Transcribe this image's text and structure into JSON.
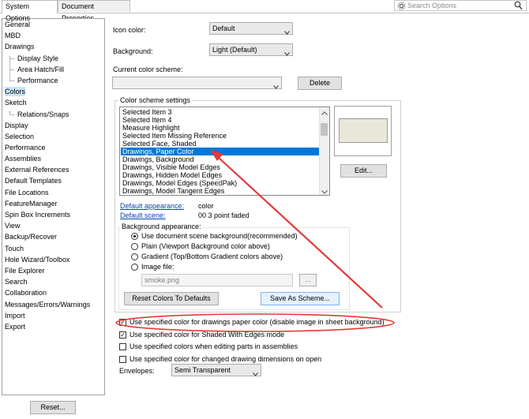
{
  "tabs": [
    {
      "label": "System Options"
    },
    {
      "label": "Document Properties"
    }
  ],
  "search": {
    "placeholder": "Search Options"
  },
  "tree": {
    "items": [
      {
        "label": "General"
      },
      {
        "label": "MBD"
      },
      {
        "label": "Drawings"
      },
      {
        "label": "Display Style"
      },
      {
        "label": "Area Hatch/Fill"
      },
      {
        "label": "Performance"
      },
      {
        "label": "Colors"
      },
      {
        "label": "Sketch"
      },
      {
        "label": "Relations/Snaps"
      },
      {
        "label": "Display"
      },
      {
        "label": "Selection"
      },
      {
        "label": "Performance"
      },
      {
        "label": "Assemblies"
      },
      {
        "label": "External References"
      },
      {
        "label": "Default Templates"
      },
      {
        "label": "File Locations"
      },
      {
        "label": "FeatureManager"
      },
      {
        "label": "Spin Box Increments"
      },
      {
        "label": "View"
      },
      {
        "label": "Backup/Recover"
      },
      {
        "label": "Touch"
      },
      {
        "label": "Hole Wizard/Toolbox"
      },
      {
        "label": "File Explorer"
      },
      {
        "label": "Search"
      },
      {
        "label": "Collaboration"
      },
      {
        "label": "Messages/Errors/Warnings"
      },
      {
        "label": "Import"
      },
      {
        "label": "Export"
      }
    ],
    "reset_label": "Reset..."
  },
  "icon_color": {
    "label": "Icon color:",
    "value": "Default"
  },
  "background": {
    "label": "Background:",
    "value": "Light (Default)"
  },
  "scheme": {
    "label": "Current color scheme:",
    "value": "",
    "delete_label": "Delete"
  },
  "settings": {
    "group_label": "Color scheme settings",
    "items": [
      "Selected Item 3",
      "Selected Item 4",
      "Measure Highlight",
      "Selected Item Missing Reference",
      "Selected Face, Shaded",
      "Drawings, Paper Color",
      "Drawings, Background",
      "Drawings, Visible Model Edges",
      "Drawings, Hidden Model Edges",
      "Drawings, Model Edges (SpeedPak)",
      "Drawings, Model Tangent Edges"
    ],
    "selected_index": 5,
    "edit_label": "Edit...",
    "swatch_color": "#e9e7da",
    "default_appearance_label": "Default appearance:",
    "default_appearance_value": "color",
    "default_scene_label": "Default scene:",
    "default_scene_value": "00 3 point faded",
    "bg_appearance_label": "Background appearance:",
    "radios": [
      "Use document scene background(recommended)",
      "Plain (Viewport Background color above)",
      "Gradient (Top/Bottom Gradient colors above)",
      "Image file:"
    ],
    "image_file": "smoke.png",
    "browse_label": "...",
    "reset_colors_label": "Reset Colors To Defaults",
    "save_scheme_label": "Save As Scheme..."
  },
  "checks": [
    {
      "label": "Use specified color for drawings paper color (disable image in sheet background)",
      "checked": true
    },
    {
      "label": "Use specified color for Shaded With Edges mode",
      "checked": true
    },
    {
      "label": "Use specified colors when editing parts in assemblies",
      "checked": false
    },
    {
      "label": "Use specified color for changed drawing dimensions on open",
      "checked": false
    }
  ],
  "envelopes": {
    "label": "Envelopes:",
    "value": "Semi Transparent"
  },
  "colors": {
    "annotation_red": "#e53a3a",
    "selection_blue": "#0078d7",
    "link_blue": "#0645ad"
  }
}
